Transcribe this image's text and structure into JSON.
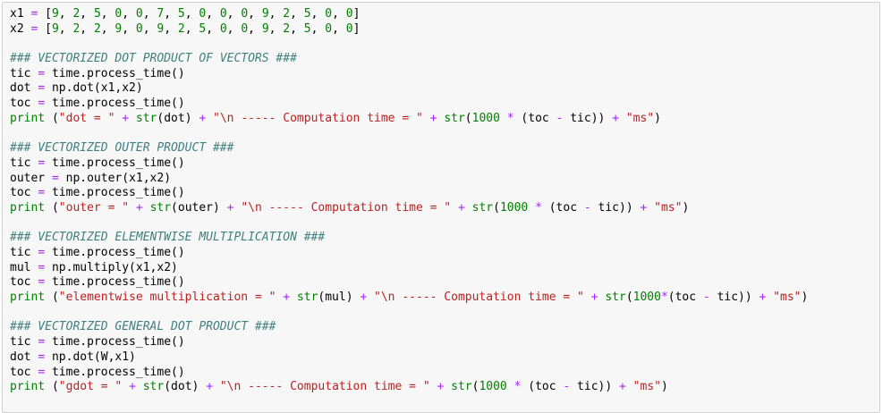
{
  "code_lines": [
    [
      {
        "t": "x1 ",
        "c": "var"
      },
      {
        "t": "=",
        "c": "op"
      },
      {
        "t": " [",
        "c": "var"
      },
      {
        "t": "9",
        "c": "num"
      },
      {
        "t": ", ",
        "c": "var"
      },
      {
        "t": "2",
        "c": "num"
      },
      {
        "t": ", ",
        "c": "var"
      },
      {
        "t": "5",
        "c": "num"
      },
      {
        "t": ", ",
        "c": "var"
      },
      {
        "t": "0",
        "c": "num"
      },
      {
        "t": ", ",
        "c": "var"
      },
      {
        "t": "0",
        "c": "num"
      },
      {
        "t": ", ",
        "c": "var"
      },
      {
        "t": "7",
        "c": "num"
      },
      {
        "t": ", ",
        "c": "var"
      },
      {
        "t": "5",
        "c": "num"
      },
      {
        "t": ", ",
        "c": "var"
      },
      {
        "t": "0",
        "c": "num"
      },
      {
        "t": ", ",
        "c": "var"
      },
      {
        "t": "0",
        "c": "num"
      },
      {
        "t": ", ",
        "c": "var"
      },
      {
        "t": "0",
        "c": "num"
      },
      {
        "t": ", ",
        "c": "var"
      },
      {
        "t": "9",
        "c": "num"
      },
      {
        "t": ", ",
        "c": "var"
      },
      {
        "t": "2",
        "c": "num"
      },
      {
        "t": ", ",
        "c": "var"
      },
      {
        "t": "5",
        "c": "num"
      },
      {
        "t": ", ",
        "c": "var"
      },
      {
        "t": "0",
        "c": "num"
      },
      {
        "t": ", ",
        "c": "var"
      },
      {
        "t": "0",
        "c": "num"
      },
      {
        "t": "]",
        "c": "var"
      }
    ],
    [
      {
        "t": "x2 ",
        "c": "var"
      },
      {
        "t": "=",
        "c": "op"
      },
      {
        "t": " [",
        "c": "var"
      },
      {
        "t": "9",
        "c": "num"
      },
      {
        "t": ", ",
        "c": "var"
      },
      {
        "t": "2",
        "c": "num"
      },
      {
        "t": ", ",
        "c": "var"
      },
      {
        "t": "2",
        "c": "num"
      },
      {
        "t": ", ",
        "c": "var"
      },
      {
        "t": "9",
        "c": "num"
      },
      {
        "t": ", ",
        "c": "var"
      },
      {
        "t": "0",
        "c": "num"
      },
      {
        "t": ", ",
        "c": "var"
      },
      {
        "t": "9",
        "c": "num"
      },
      {
        "t": ", ",
        "c": "var"
      },
      {
        "t": "2",
        "c": "num"
      },
      {
        "t": ", ",
        "c": "var"
      },
      {
        "t": "5",
        "c": "num"
      },
      {
        "t": ", ",
        "c": "var"
      },
      {
        "t": "0",
        "c": "num"
      },
      {
        "t": ", ",
        "c": "var"
      },
      {
        "t": "0",
        "c": "num"
      },
      {
        "t": ", ",
        "c": "var"
      },
      {
        "t": "9",
        "c": "num"
      },
      {
        "t": ", ",
        "c": "var"
      },
      {
        "t": "2",
        "c": "num"
      },
      {
        "t": ", ",
        "c": "var"
      },
      {
        "t": "5",
        "c": "num"
      },
      {
        "t": ", ",
        "c": "var"
      },
      {
        "t": "0",
        "c": "num"
      },
      {
        "t": ", ",
        "c": "var"
      },
      {
        "t": "0",
        "c": "num"
      },
      {
        "t": "]",
        "c": "var"
      }
    ],
    [],
    [
      {
        "t": "### VECTORIZED DOT PRODUCT OF VECTORS ###",
        "c": "cm"
      }
    ],
    [
      {
        "t": "tic ",
        "c": "var"
      },
      {
        "t": "=",
        "c": "op"
      },
      {
        "t": " time.process_time()",
        "c": "var"
      }
    ],
    [
      {
        "t": "dot ",
        "c": "var"
      },
      {
        "t": "=",
        "c": "op"
      },
      {
        "t": " np.dot(x1,x2)",
        "c": "var"
      }
    ],
    [
      {
        "t": "toc ",
        "c": "var"
      },
      {
        "t": "=",
        "c": "op"
      },
      {
        "t": " time.process_time()",
        "c": "var"
      }
    ],
    [
      {
        "t": "print",
        "c": "kw"
      },
      {
        "t": " (",
        "c": "var"
      },
      {
        "t": "\"dot = \"",
        "c": "str"
      },
      {
        "t": " ",
        "c": "var"
      },
      {
        "t": "+",
        "c": "op"
      },
      {
        "t": " ",
        "c": "var"
      },
      {
        "t": "str",
        "c": "kw"
      },
      {
        "t": "(dot) ",
        "c": "var"
      },
      {
        "t": "+",
        "c": "op"
      },
      {
        "t": " ",
        "c": "var"
      },
      {
        "t": "\"\\n ----- Computation time = \"",
        "c": "str"
      },
      {
        "t": " ",
        "c": "var"
      },
      {
        "t": "+",
        "c": "op"
      },
      {
        "t": " ",
        "c": "var"
      },
      {
        "t": "str",
        "c": "kw"
      },
      {
        "t": "(",
        "c": "var"
      },
      {
        "t": "1000",
        "c": "num"
      },
      {
        "t": " ",
        "c": "var"
      },
      {
        "t": "*",
        "c": "op"
      },
      {
        "t": " (toc ",
        "c": "var"
      },
      {
        "t": "-",
        "c": "op"
      },
      {
        "t": " tic)) ",
        "c": "var"
      },
      {
        "t": "+",
        "c": "op"
      },
      {
        "t": " ",
        "c": "var"
      },
      {
        "t": "\"ms\"",
        "c": "str"
      },
      {
        "t": ")",
        "c": "var"
      }
    ],
    [],
    [
      {
        "t": "### VECTORIZED OUTER PRODUCT ###",
        "c": "cm"
      }
    ],
    [
      {
        "t": "tic ",
        "c": "var"
      },
      {
        "t": "=",
        "c": "op"
      },
      {
        "t": " time.process_time()",
        "c": "var"
      }
    ],
    [
      {
        "t": "outer ",
        "c": "var"
      },
      {
        "t": "=",
        "c": "op"
      },
      {
        "t": " np.outer(x1,x2)",
        "c": "var"
      }
    ],
    [
      {
        "t": "toc ",
        "c": "var"
      },
      {
        "t": "=",
        "c": "op"
      },
      {
        "t": " time.process_time()",
        "c": "var"
      }
    ],
    [
      {
        "t": "print",
        "c": "kw"
      },
      {
        "t": " (",
        "c": "var"
      },
      {
        "t": "\"outer = \"",
        "c": "str"
      },
      {
        "t": " ",
        "c": "var"
      },
      {
        "t": "+",
        "c": "op"
      },
      {
        "t": " ",
        "c": "var"
      },
      {
        "t": "str",
        "c": "kw"
      },
      {
        "t": "(outer) ",
        "c": "var"
      },
      {
        "t": "+",
        "c": "op"
      },
      {
        "t": " ",
        "c": "var"
      },
      {
        "t": "\"\\n ----- Computation time = \"",
        "c": "str"
      },
      {
        "t": " ",
        "c": "var"
      },
      {
        "t": "+",
        "c": "op"
      },
      {
        "t": " ",
        "c": "var"
      },
      {
        "t": "str",
        "c": "kw"
      },
      {
        "t": "(",
        "c": "var"
      },
      {
        "t": "1000",
        "c": "num"
      },
      {
        "t": " ",
        "c": "var"
      },
      {
        "t": "*",
        "c": "op"
      },
      {
        "t": " (toc ",
        "c": "var"
      },
      {
        "t": "-",
        "c": "op"
      },
      {
        "t": " tic)) ",
        "c": "var"
      },
      {
        "t": "+",
        "c": "op"
      },
      {
        "t": " ",
        "c": "var"
      },
      {
        "t": "\"ms\"",
        "c": "str"
      },
      {
        "t": ")",
        "c": "var"
      }
    ],
    [],
    [
      {
        "t": "### VECTORIZED ELEMENTWISE MULTIPLICATION ###",
        "c": "cm"
      }
    ],
    [
      {
        "t": "tic ",
        "c": "var"
      },
      {
        "t": "=",
        "c": "op"
      },
      {
        "t": " time.process_time()",
        "c": "var"
      }
    ],
    [
      {
        "t": "mul ",
        "c": "var"
      },
      {
        "t": "=",
        "c": "op"
      },
      {
        "t": " np.multiply(x1,x2)",
        "c": "var"
      }
    ],
    [
      {
        "t": "toc ",
        "c": "var"
      },
      {
        "t": "=",
        "c": "op"
      },
      {
        "t": " time.process_time()",
        "c": "var"
      }
    ],
    [
      {
        "t": "print",
        "c": "kw"
      },
      {
        "t": " (",
        "c": "var"
      },
      {
        "t": "\"elementwise multiplication = \"",
        "c": "str"
      },
      {
        "t": " ",
        "c": "var"
      },
      {
        "t": "+",
        "c": "op"
      },
      {
        "t": " ",
        "c": "var"
      },
      {
        "t": "str",
        "c": "kw"
      },
      {
        "t": "(mul) ",
        "c": "var"
      },
      {
        "t": "+",
        "c": "op"
      },
      {
        "t": " ",
        "c": "var"
      },
      {
        "t": "\"\\n ----- Computation time = \"",
        "c": "str"
      },
      {
        "t": " ",
        "c": "var"
      },
      {
        "t": "+",
        "c": "op"
      },
      {
        "t": " ",
        "c": "var"
      },
      {
        "t": "str",
        "c": "kw"
      },
      {
        "t": "(",
        "c": "var"
      },
      {
        "t": "1000",
        "c": "num"
      },
      {
        "t": "*",
        "c": "op"
      },
      {
        "t": "(toc ",
        "c": "var"
      },
      {
        "t": "-",
        "c": "op"
      },
      {
        "t": " tic)) ",
        "c": "var"
      },
      {
        "t": "+",
        "c": "op"
      },
      {
        "t": " ",
        "c": "var"
      },
      {
        "t": "\"ms\"",
        "c": "str"
      },
      {
        "t": ")",
        "c": "var"
      }
    ],
    [],
    [
      {
        "t": "### VECTORIZED GENERAL DOT PRODUCT ###",
        "c": "cm"
      }
    ],
    [
      {
        "t": "tic ",
        "c": "var"
      },
      {
        "t": "=",
        "c": "op"
      },
      {
        "t": " time.process_time()",
        "c": "var"
      }
    ],
    [
      {
        "t": "dot ",
        "c": "var"
      },
      {
        "t": "=",
        "c": "op"
      },
      {
        "t": " np.dot(W,x1)",
        "c": "var"
      }
    ],
    [
      {
        "t": "toc ",
        "c": "var"
      },
      {
        "t": "=",
        "c": "op"
      },
      {
        "t": " time.process_time()",
        "c": "var"
      }
    ],
    [
      {
        "t": "print",
        "c": "kw"
      },
      {
        "t": " (",
        "c": "var"
      },
      {
        "t": "\"gdot = \"",
        "c": "str"
      },
      {
        "t": " ",
        "c": "var"
      },
      {
        "t": "+",
        "c": "op"
      },
      {
        "t": " ",
        "c": "var"
      },
      {
        "t": "str",
        "c": "kw"
      },
      {
        "t": "(dot) ",
        "c": "var"
      },
      {
        "t": "+",
        "c": "op"
      },
      {
        "t": " ",
        "c": "var"
      },
      {
        "t": "\"\\n ----- Computation time = \"",
        "c": "str"
      },
      {
        "t": " ",
        "c": "var"
      },
      {
        "t": "+",
        "c": "op"
      },
      {
        "t": " ",
        "c": "var"
      },
      {
        "t": "str",
        "c": "kw"
      },
      {
        "t": "(",
        "c": "var"
      },
      {
        "t": "1000",
        "c": "num"
      },
      {
        "t": " ",
        "c": "var"
      },
      {
        "t": "*",
        "c": "op"
      },
      {
        "t": " (toc ",
        "c": "var"
      },
      {
        "t": "-",
        "c": "op"
      },
      {
        "t": " tic)) ",
        "c": "var"
      },
      {
        "t": "+",
        "c": "op"
      },
      {
        "t": " ",
        "c": "var"
      },
      {
        "t": "\"ms\"",
        "c": "str"
      },
      {
        "t": ")",
        "c": "var"
      }
    ]
  ]
}
